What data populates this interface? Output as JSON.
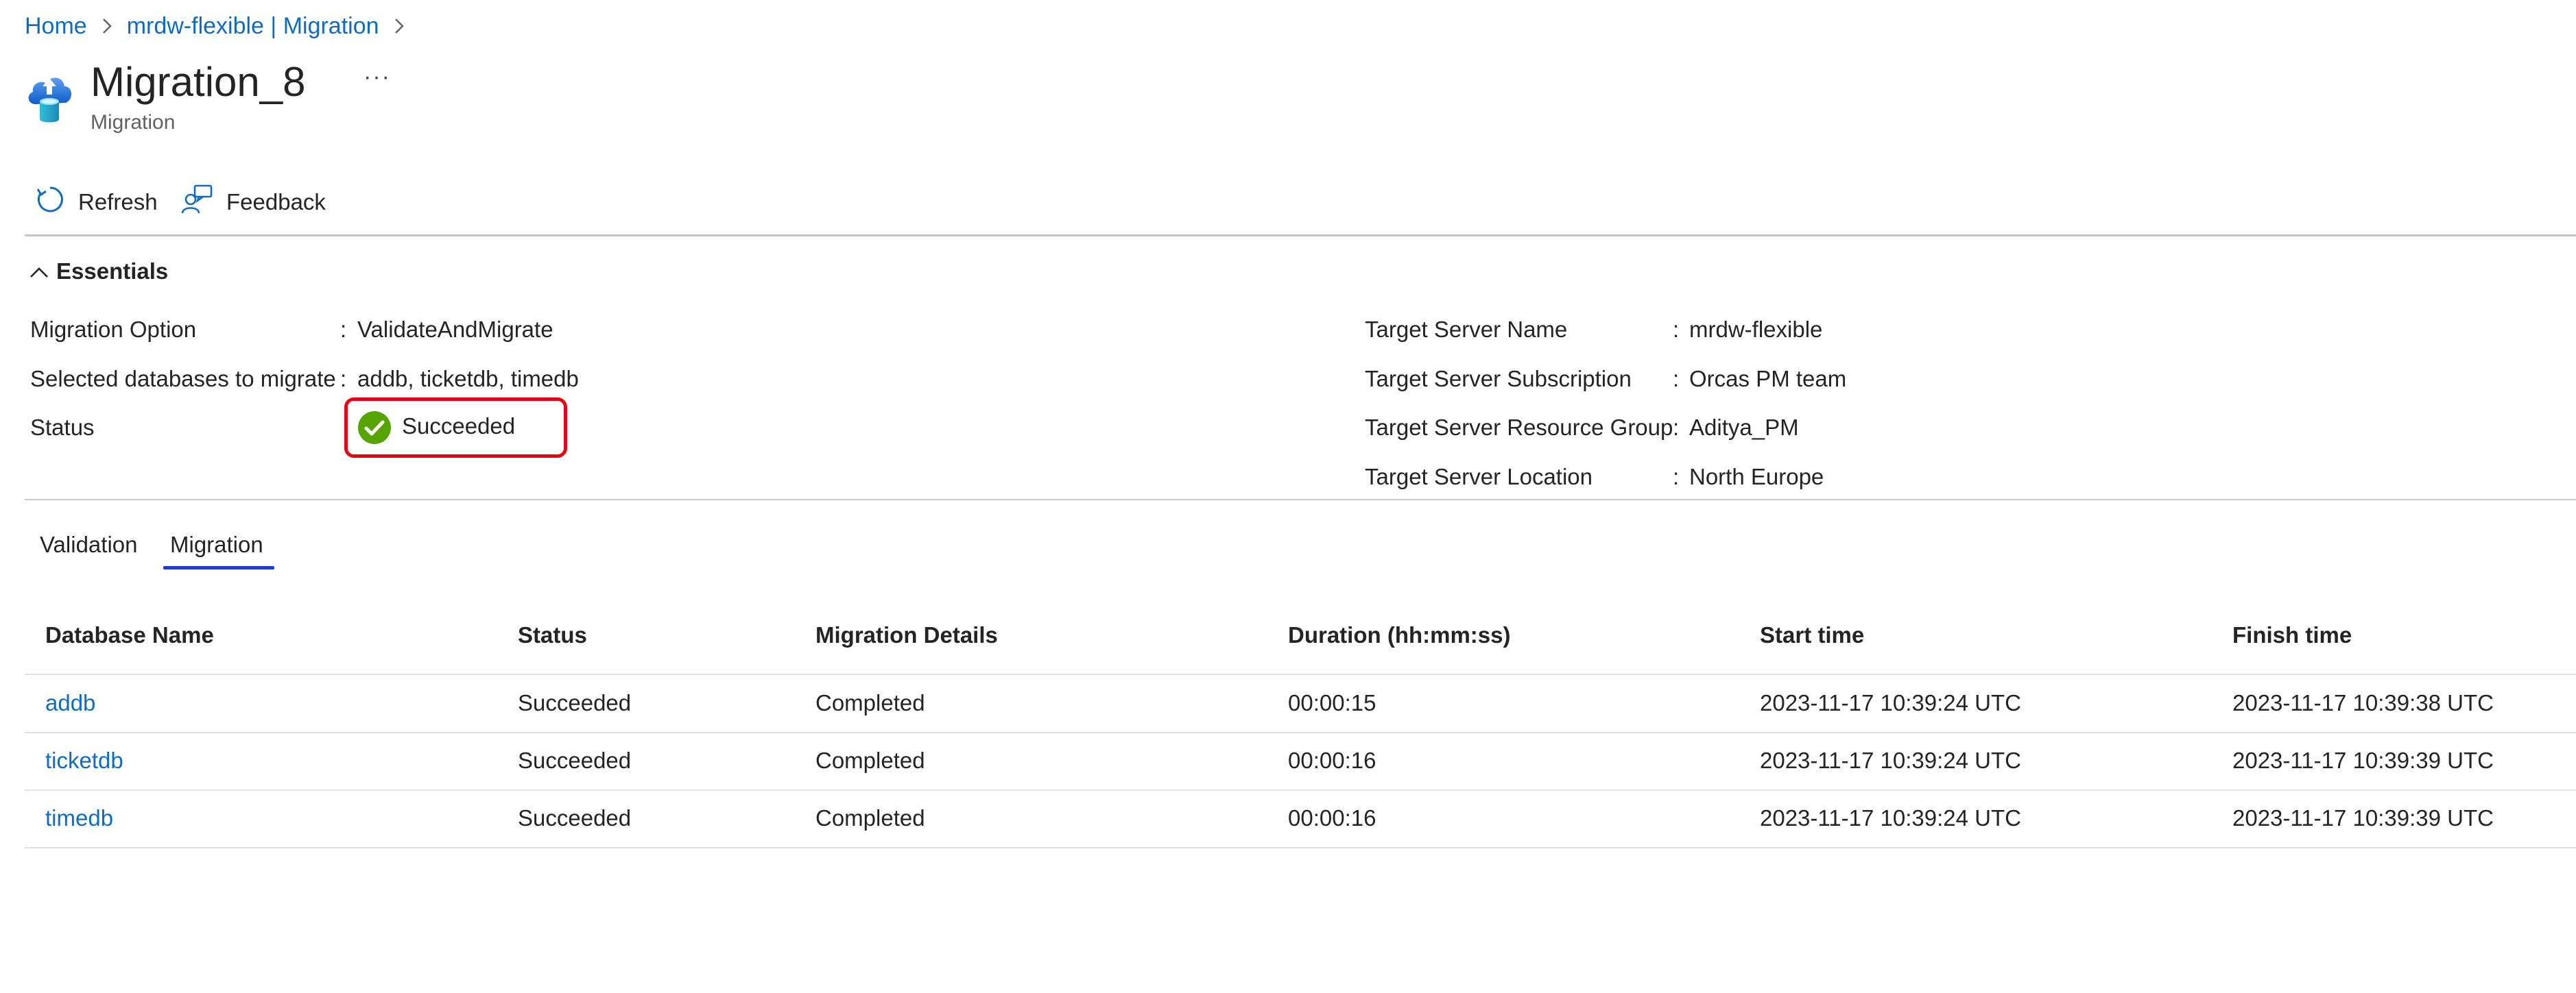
{
  "breadcrumb": {
    "items": [
      "Home",
      "mrdw-flexible | Migration"
    ]
  },
  "header": {
    "title": "Migration_8",
    "more_label": "···",
    "subtitle": "Migration"
  },
  "toolbar": {
    "refresh_label": "Refresh",
    "feedback_label": "Feedback"
  },
  "essentials": {
    "toggle_label": "Essentials",
    "left": [
      {
        "label": "Migration Option",
        "value": "ValidateAndMigrate"
      },
      {
        "label": "Selected databases to migrate",
        "value": "addb, ticketdb, timedb"
      },
      {
        "label": "Status",
        "value": "Succeeded"
      }
    ],
    "right": [
      {
        "label": "Target Server Name",
        "value": "mrdw-flexible"
      },
      {
        "label": "Target Server Subscription",
        "value": "Orcas PM team"
      },
      {
        "label": "Target Server Resource Group",
        "value": "Aditya_PM"
      },
      {
        "label": "Target Server Location",
        "value": "North Europe"
      }
    ],
    "colon": ":"
  },
  "tabs": [
    {
      "label": "Validation"
    },
    {
      "label": "Migration",
      "selected": true
    }
  ],
  "table": {
    "columns": [
      "Database Name",
      "Status",
      "Migration Details",
      "Duration (hh:mm:ss)",
      "Start time",
      "Finish time"
    ],
    "rows": [
      [
        "addb",
        "Succeeded",
        "Completed",
        "00:00:15",
        "2023-11-17 10:39:24 UTC",
        "2023-11-17 10:39:38 UTC"
      ],
      [
        "ticketdb",
        "Succeeded",
        "Completed",
        "00:00:16",
        "2023-11-17 10:39:24 UTC",
        "2023-11-17 10:39:39 UTC"
      ],
      [
        "timedb",
        "Succeeded",
        "Completed",
        "00:00:16",
        "2023-11-17 10:39:24 UTC",
        "2023-11-17 10:39:39 UTC"
      ]
    ]
  },
  "colors": {
    "link": "#0f6cbd",
    "success": "#57a300",
    "highlight_border": "#e30613",
    "tab_underline": "#1a3fd0"
  },
  "icons": {
    "resource": "cloud-database-upload-icon",
    "refresh": "refresh-icon",
    "feedback": "feedback-person-icon",
    "breadcrumb_separator": "chevron-right-icon",
    "essentials_toggle": "chevron-up-icon",
    "status": "success-check-icon"
  }
}
